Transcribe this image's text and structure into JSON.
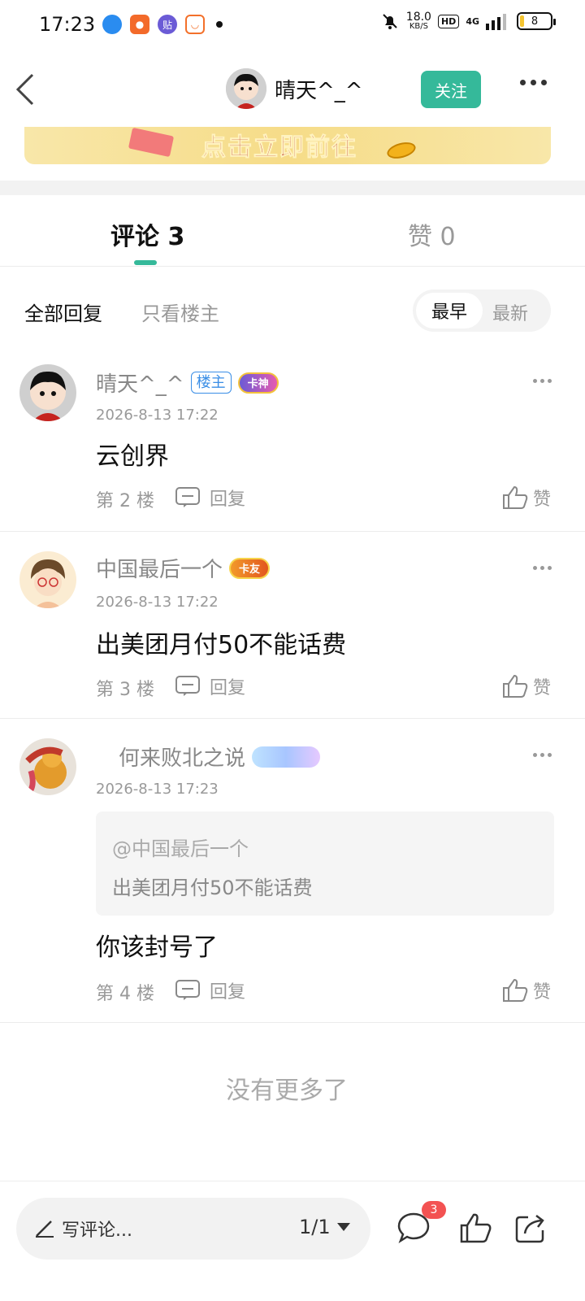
{
  "status_bar": {
    "time": "17:23",
    "net_speed": "18.0",
    "net_unit": "KB/S",
    "hd": "HD",
    "network": "4G",
    "battery": "8",
    "app_icons": [
      "browser-icon",
      "app-icon",
      "tieba-icon",
      "taobao-icon"
    ]
  },
  "header": {
    "username": "晴天^_^",
    "follow_label": "关注"
  },
  "banner": {
    "text": "点击立即前往"
  },
  "tabs": {
    "comments_label": "评论 3",
    "likes_label": "赞 0"
  },
  "filter": {
    "all_label": "全部回复",
    "op_only_label": "只看楼主",
    "sort_earliest": "最早",
    "sort_latest": "最新"
  },
  "comments": [
    {
      "username": "晴天^_^",
      "owner_badge": "楼主",
      "rank_badge": "卡神",
      "time": "2026-8-13 17:22",
      "text": "云创界",
      "floor": "第 2 楼",
      "reply_label": "回复",
      "like_label": "赞"
    },
    {
      "username": "中国最后一个",
      "rank_badge": "卡友",
      "time": "2026-8-13 17:22",
      "text": "出美团月付50不能话费",
      "floor": "第 3 楼",
      "reply_label": "回复",
      "like_label": "赞"
    },
    {
      "username": "何来败北之说",
      "time": "2026-8-13 17:23",
      "quote_user": "@中国最后一个",
      "quote_text": "出美团月付50不能话费",
      "text": "你该封号了",
      "floor": "第 4 楼",
      "reply_label": "回复",
      "like_label": "赞"
    }
  ],
  "no_more": "没有更多了",
  "bottom_bar": {
    "write_placeholder": "写评论...",
    "page_indicator": "1/1",
    "comment_count": "3"
  },
  "colors": {
    "accent": "#35b99a",
    "badge_red": "#f35252",
    "owner_blue": "#3a8ee6"
  }
}
